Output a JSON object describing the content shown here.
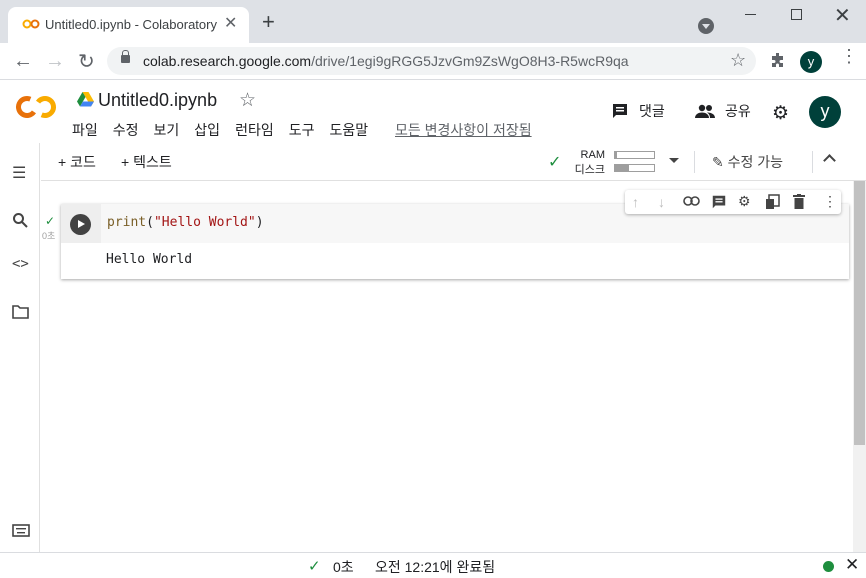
{
  "browser": {
    "tab_title": "Untitled0.ipynb - Colaboratory",
    "tab_close": "✕",
    "new_tab": "+",
    "url_host": "colab.research.google.com",
    "url_path": "/drive/1egi9gRGG5JzvGm9ZsWgO8H3-R5wcR9qa",
    "profile_initial": "y"
  },
  "colab": {
    "notebook_title": "Untitled0.ipynb",
    "menu": [
      "파일",
      "수정",
      "보기",
      "삽입",
      "런타임",
      "도구",
      "도움말"
    ],
    "saved_status": "모든 변경사항이 저장됨",
    "comment_label": "댓글",
    "share_label": "공유",
    "profile_initial": "y"
  },
  "toolbar": {
    "add_code": "+ 코드",
    "add_text": "+ 텍스트",
    "ram_label": "RAM",
    "disk_label": "디스크",
    "ram_usage": 0.05,
    "disk_usage": 0.35,
    "edit_mode": "수정 가능"
  },
  "cell": {
    "exec_time": "0초",
    "code_func": "print",
    "code_open": "(",
    "code_string": "\"Hello World\"",
    "code_close": ")",
    "output": "Hello World"
  },
  "status": {
    "time": "0초",
    "done": "오전 12:21에 완료됨"
  },
  "icons": {
    "colab_logo": "colab-logo",
    "drive": "google-drive-icon",
    "accent_orange": "#f9ab00",
    "accent_green": "#1e8e3e"
  }
}
